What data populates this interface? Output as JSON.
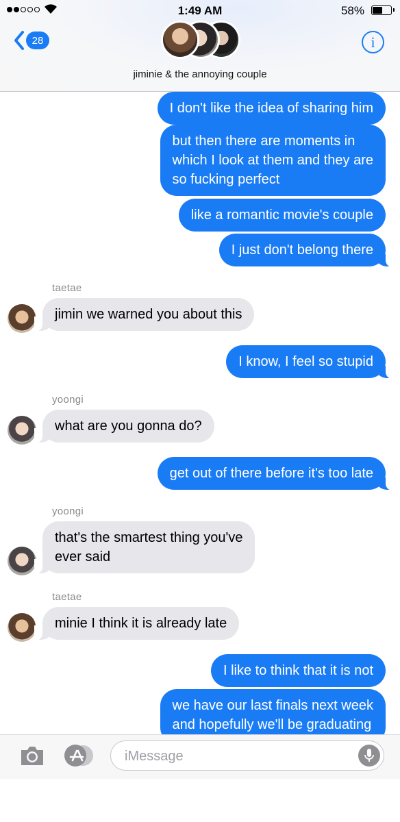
{
  "status": {
    "time": "1:49 AM",
    "battery": "58%",
    "battery_level": 0.58
  },
  "header": {
    "back_count": "28",
    "title": "jiminie & the annoying couple",
    "info_label": "i"
  },
  "messages": [
    {
      "dir": "out",
      "text": "I don't like the idea of sharing him"
    },
    {
      "dir": "out",
      "lines": [
        "but then there are moments in",
        "which I look at them and they are",
        "so fucking perfect"
      ]
    },
    {
      "dir": "out",
      "text": "like a romantic movie's couple"
    },
    {
      "dir": "out",
      "text": "I just don't belong there"
    },
    {
      "dir": "in",
      "sender": "taetae",
      "text": "jimin we warned you about this"
    },
    {
      "dir": "out",
      "text": "I know, I feel so stupid"
    },
    {
      "dir": "in",
      "sender": "yoongi",
      "text": "what are you gonna do?"
    },
    {
      "dir": "out",
      "text": "get out of there before it's too late"
    },
    {
      "dir": "in",
      "sender": "yoongi",
      "lines": [
        "that's the smartest thing you've",
        "ever said"
      ]
    },
    {
      "dir": "in",
      "sender": "taetae",
      "text": "minie I think it is already late"
    },
    {
      "dir": "out",
      "text": "I like to think that it is not"
    },
    {
      "dir": "out",
      "lines": [
        "we have our last finals next week",
        "and hopefully we'll be graduating"
      ]
    }
  ],
  "input": {
    "placeholder": "iMessage"
  },
  "colors": {
    "accent": "#1a7cf5",
    "incoming": "#e6e6eb"
  },
  "icons": [
    "signal-icon",
    "wifi-icon",
    "battery-icon",
    "back-chevron-icon",
    "info-icon",
    "camera-icon",
    "app-store-icon",
    "microphone-icon"
  ]
}
